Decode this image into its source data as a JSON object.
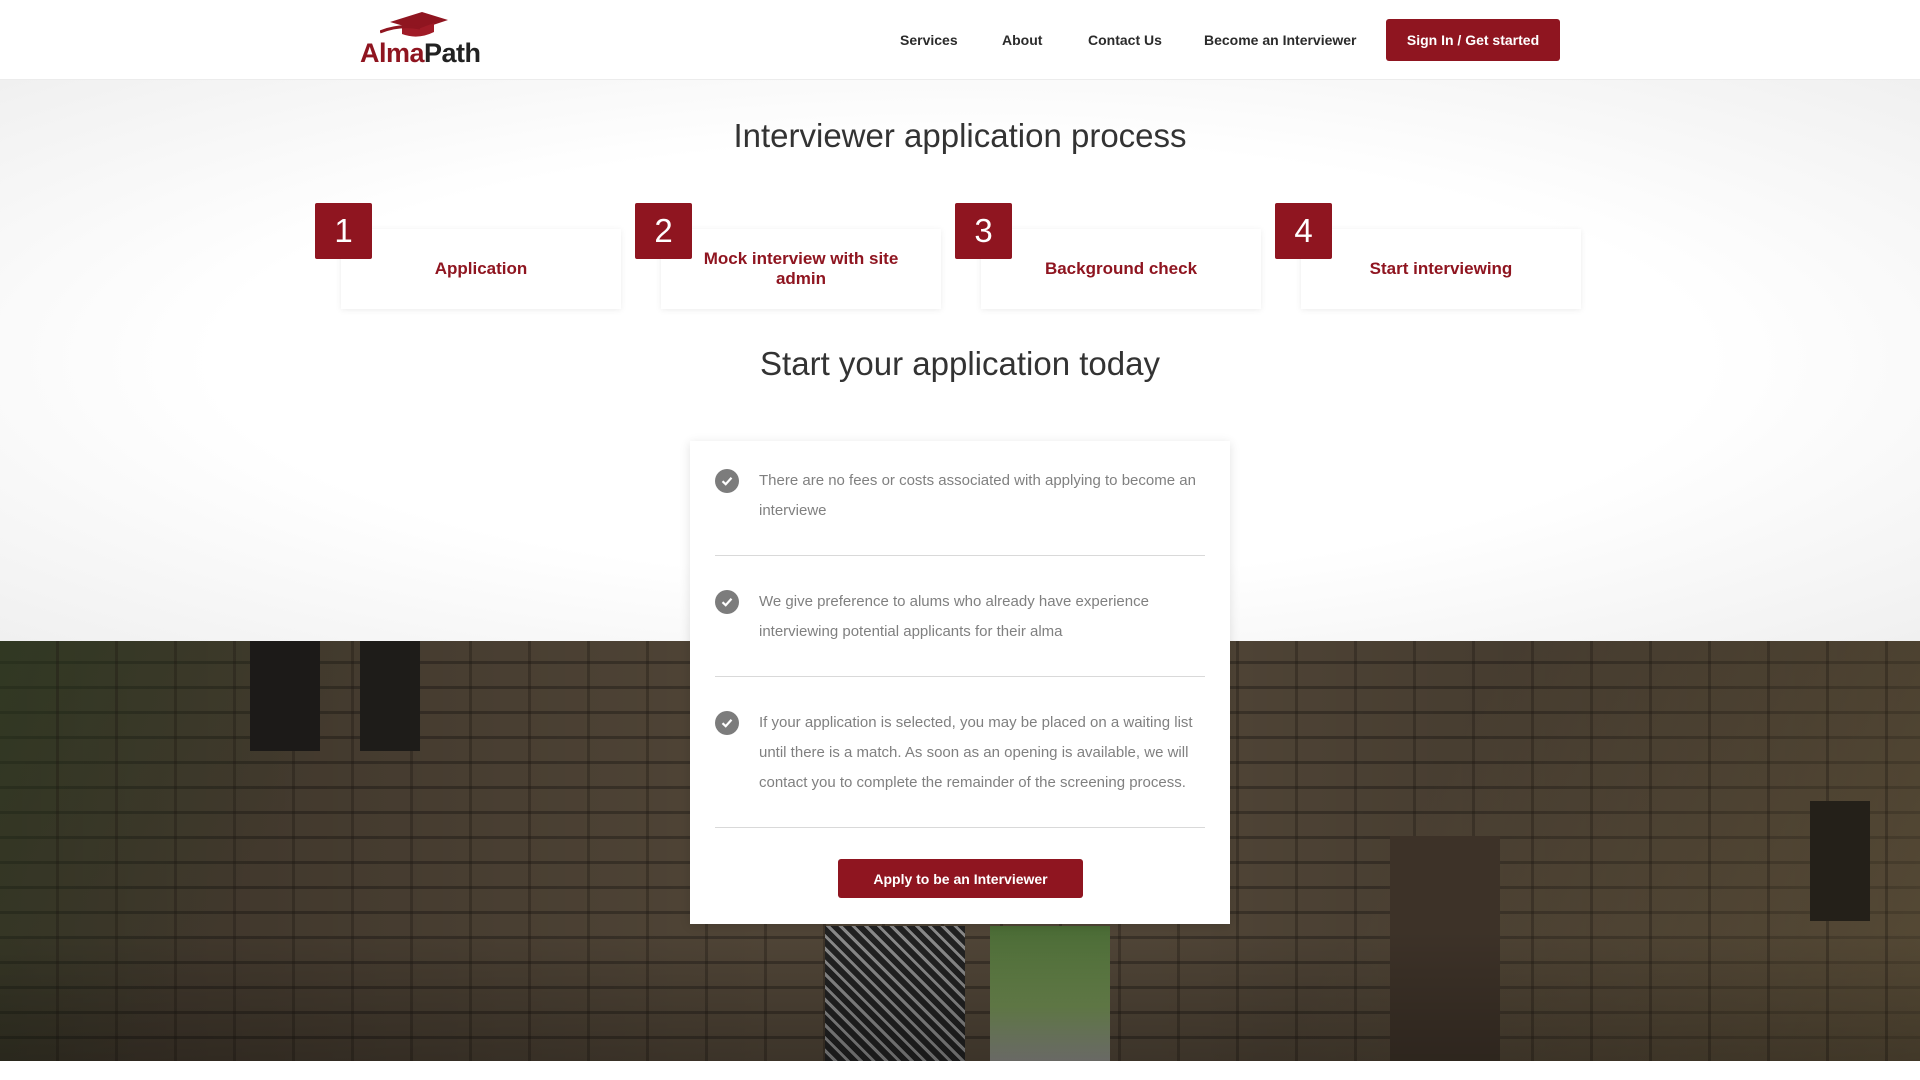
{
  "brand": {
    "name_part1": "Alma",
    "name_part2": "Path",
    "accent_color": "#8f1520"
  },
  "nav": {
    "items": [
      "Services",
      "About",
      "Contact Us",
      "Become an Interviewer"
    ],
    "cta_label": "Sign In / Get started"
  },
  "process": {
    "title": "Interviewer application process",
    "steps": [
      {
        "number": "1",
        "label": "Application"
      },
      {
        "number": "2",
        "label": "Mock interview with site admin"
      },
      {
        "number": "3",
        "label": "Background check"
      },
      {
        "number": "4",
        "label": "Start interviewing"
      }
    ]
  },
  "apply": {
    "title": "Start your application today",
    "points": [
      "There are no fees or costs associated with applying to become an interviewe",
      "We give preference to alums who already have experience interviewing potential applicants for their alma",
      "If your application is selected, you may be placed on a waiting list until there is a match. As soon as an opening is available, we will contact you to complete the remainder of the screening process."
    ],
    "button_label": "Apply to be an Interviewer"
  },
  "icons": {
    "check": "check-circle-icon",
    "logo": "graduation-cap-icon"
  }
}
